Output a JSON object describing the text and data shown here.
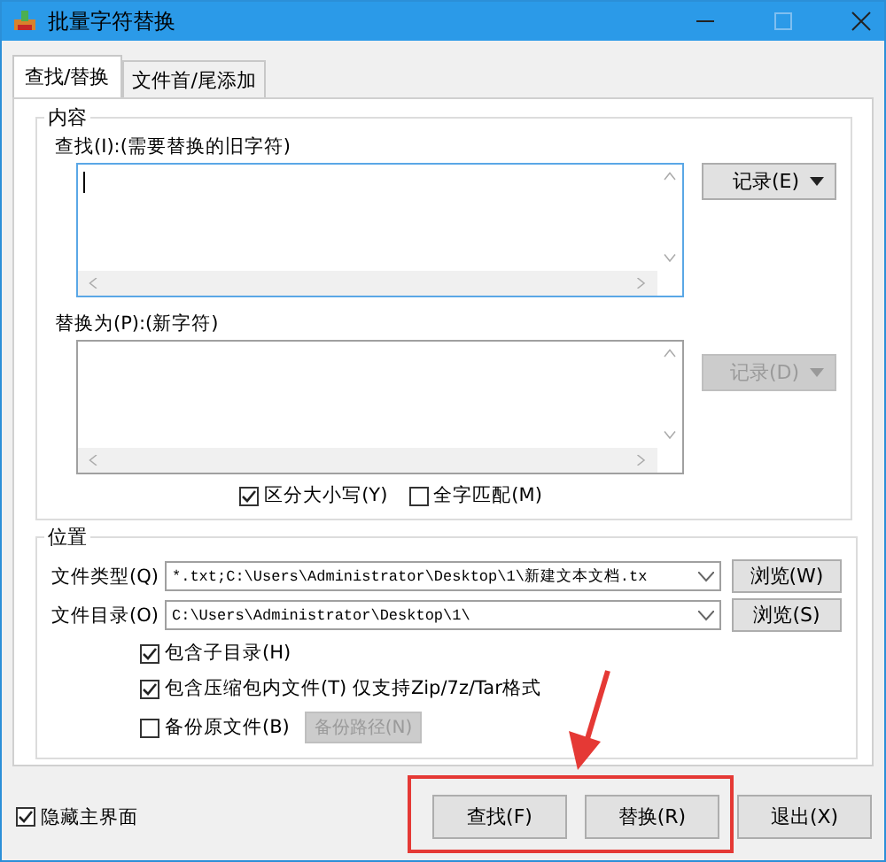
{
  "window": {
    "title": "批量字符替换"
  },
  "tabs": [
    {
      "label": "查找/替换",
      "selected": true
    },
    {
      "label": "文件首/尾添加",
      "selected": false
    }
  ],
  "content_group": {
    "title": "内容",
    "find": {
      "label": "查找(I):(需要替换的旧字符)",
      "history_button": {
        "label": "记录(E)",
        "disabled": false
      }
    },
    "replace": {
      "label": "替换为(P):(新字符)",
      "history_button": {
        "label": "记录(D)",
        "disabled": true
      }
    },
    "options": [
      {
        "label": "区分大小写(Y)",
        "checked": true
      },
      {
        "label": "全字匹配(M)",
        "checked": false
      }
    ]
  },
  "location_group": {
    "title": "位置",
    "rows": [
      {
        "label": "文件类型(Q)",
        "value": "*.txt;C:\\Users\\Administrator\\Desktop\\1\\新建文本文档.tx",
        "button": "浏览(W)"
      },
      {
        "label": "文件目录(O)",
        "value": "C:\\Users\\Administrator\\Desktop\\1\\",
        "button": "浏览(S)"
      }
    ],
    "options": [
      {
        "label": "包含子目录(H)",
        "checked": true
      },
      {
        "label": "包含压缩包内文件(T) 仅支持Zip/7z/Tar格式",
        "checked": true
      },
      {
        "label": "备份原文件(B)",
        "checked": false,
        "button": {
          "label": "备份路径(N)",
          "disabled": true
        }
      }
    ]
  },
  "hide_main": {
    "label": "隐藏主界面",
    "checked": true
  },
  "buttons": [
    {
      "label": "查找(F)"
    },
    {
      "label": "替换(R)"
    },
    {
      "label": "退出(X)"
    }
  ],
  "annotation": {
    "highlight_box": true,
    "arrow": true
  }
}
